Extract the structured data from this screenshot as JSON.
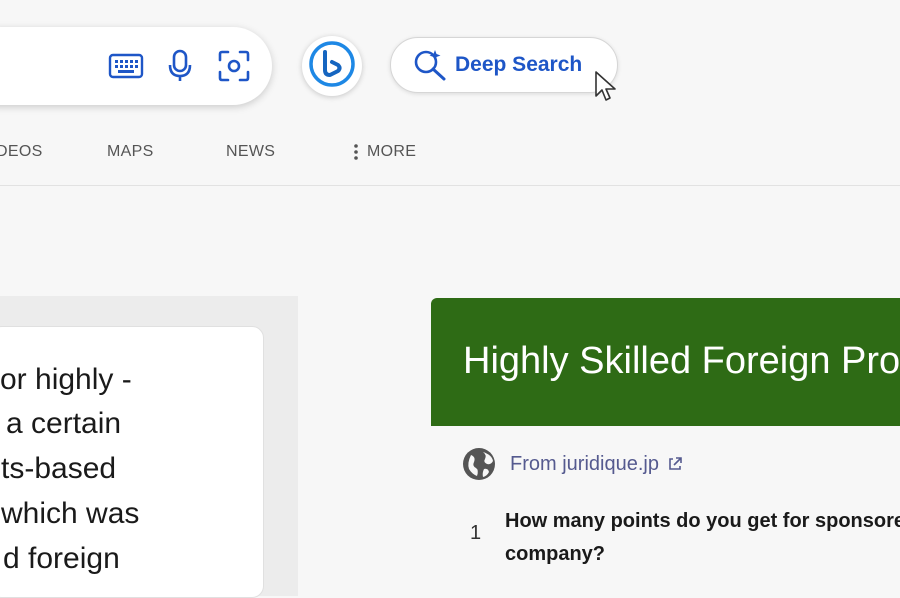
{
  "search": {
    "icons": [
      "keyboard-icon",
      "microphone-icon",
      "visual-search-icon"
    ]
  },
  "copilot": {
    "icon": "bing-copilot-icon"
  },
  "deep_search": {
    "label": "Deep Search",
    "icon": "deep-search-icon"
  },
  "tabs": [
    {
      "label": "DEOS"
    },
    {
      "label": "MAPS"
    },
    {
      "label": "NEWS"
    },
    {
      "label": "MORE",
      "icon": "kebab-icon"
    }
  ],
  "left_card": {
    "lines": [
      "or highly -",
      "a certain",
      "ts-based",
      "which was",
      "d foreign"
    ]
  },
  "right_card": {
    "banner_title": "Highly Skilled Foreign Pro",
    "banner_color": "#2e6b15",
    "source_label": "From juridique.jp",
    "question_number": "1",
    "question_text": "How many points do you get for sponsored company?"
  },
  "colors": {
    "accent": "#1e56c7",
    "source_link": "#555a8f"
  }
}
